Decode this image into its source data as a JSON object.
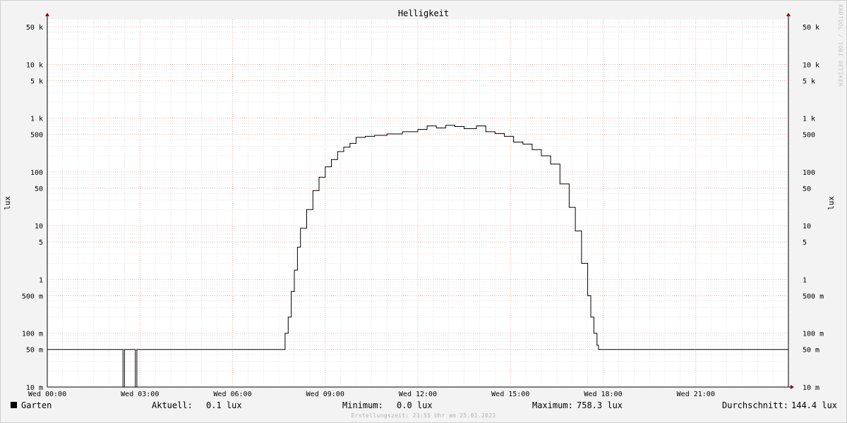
{
  "chart_data": {
    "type": "line",
    "title": "Helligkeit",
    "ylabel": "lux",
    "y_scale": "log",
    "ylim": [
      0.01,
      70000
    ],
    "x_range_hours": [
      0,
      24
    ],
    "x_ticks": [
      {
        "label": "Wed 00:00",
        "h": 0
      },
      {
        "label": "Wed 03:00",
        "h": 3
      },
      {
        "label": "Wed 06:00",
        "h": 6
      },
      {
        "label": "Wed 09:00",
        "h": 9
      },
      {
        "label": "Wed 12:00",
        "h": 12
      },
      {
        "label": "Wed 15:00",
        "h": 15
      },
      {
        "label": "Wed 18:00",
        "h": 18
      },
      {
        "label": "Wed 21:00",
        "h": 21
      }
    ],
    "y_ticks": [
      {
        "label": "50 k",
        "v": 50000
      },
      {
        "label": "10 k",
        "v": 10000
      },
      {
        "label": "5 k",
        "v": 5000
      },
      {
        "label": "1 k",
        "v": 1000
      },
      {
        "label": "500",
        "v": 500
      },
      {
        "label": "100",
        "v": 100
      },
      {
        "label": "50",
        "v": 50
      },
      {
        "label": "10",
        "v": 10
      },
      {
        "label": "5",
        "v": 5
      },
      {
        "label": "1",
        "v": 1
      },
      {
        "label": "500 m",
        "v": 0.5
      },
      {
        "label": "100 m",
        "v": 0.1
      },
      {
        "label": "50 m",
        "v": 0.05
      },
      {
        "label": "10 m",
        "v": 0.01
      }
    ],
    "grid": true,
    "series": [
      {
        "name": "Garten",
        "color": "#000000",
        "x_hours": [
          0,
          2.4,
          2.45,
          2.5,
          2.8,
          2.85,
          2.9,
          3.0,
          7.6,
          7.7,
          7.8,
          7.9,
          8.0,
          8.1,
          8.2,
          8.4,
          8.6,
          8.8,
          9.0,
          9.2,
          9.4,
          9.6,
          9.8,
          10.0,
          10.3,
          10.6,
          11.0,
          11.5,
          12.0,
          12.3,
          12.6,
          12.9,
          13.2,
          13.5,
          13.9,
          14.2,
          14.5,
          14.8,
          15.1,
          15.4,
          15.7,
          16.0,
          16.3,
          16.6,
          16.9,
          17.1,
          17.3,
          17.5,
          17.6,
          17.7,
          17.8,
          17.85,
          17.9,
          18.0,
          21.0,
          24.0
        ],
        "values": [
          0.05,
          0.05,
          0.01,
          0.05,
          0.05,
          0.01,
          0.05,
          0.05,
          0.05,
          0.1,
          0.2,
          0.6,
          1.5,
          4,
          9,
          20,
          45,
          80,
          125,
          170,
          240,
          290,
          340,
          440,
          460,
          480,
          510,
          560,
          620,
          720,
          660,
          740,
          700,
          640,
          720,
          560,
          520,
          460,
          360,
          330,
          260,
          200,
          140,
          60,
          22,
          8,
          2,
          0.5,
          0.2,
          0.1,
          0.06,
          0.05,
          0.05,
          0.05,
          0.05,
          0.05
        ]
      }
    ]
  },
  "legend": {
    "series_name": "Garten",
    "current_label": "Aktuell:",
    "current_value": "0.1 lux",
    "min_label": "Minimum:",
    "min_value": "0.0 lux",
    "max_label": "Maximum:",
    "max_value": "758.3 lux",
    "avg_label": "Durchschnitt:",
    "avg_value": "144.4 lux"
  },
  "credit": "Erstellungszeit: 23:55 Uhr am 25.01.2023",
  "watermark": "RRDTOOL / TOBI OETIKER",
  "colors": {
    "background": "#f3f3f3",
    "plot_background": "#ffffff",
    "major_grid": "#e8a0a0",
    "minor_grid": "#cfcfcf",
    "axis": "#000000",
    "arrow": "#8b0000"
  }
}
